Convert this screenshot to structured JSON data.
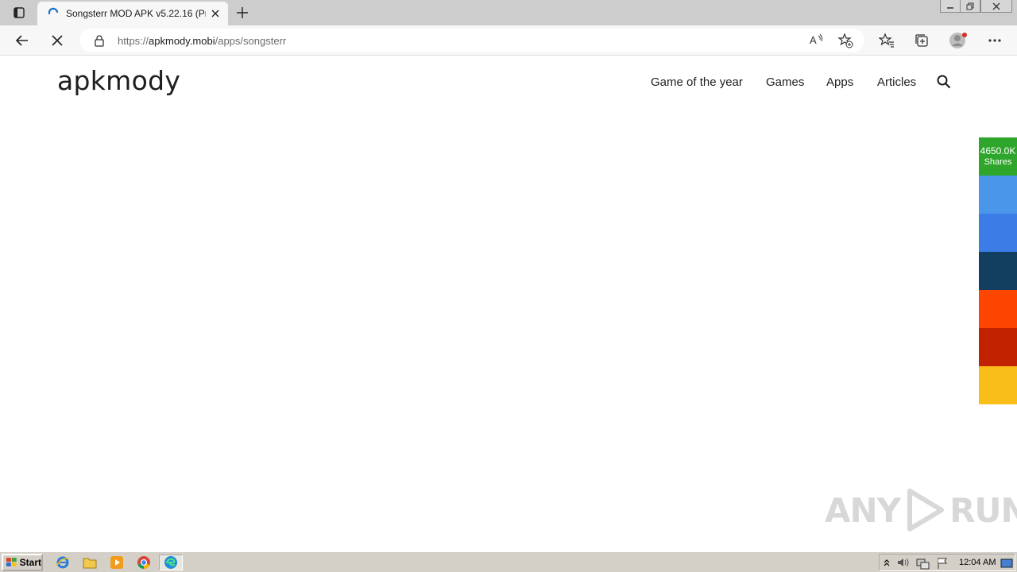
{
  "browser": {
    "tab_title": "Songsterr MOD APK v5.22.16 (Pre",
    "url_prefix": "https://",
    "url_host": "apkmody.mobi",
    "url_path": "/apps/songsterr"
  },
  "site": {
    "logo": "apkmody",
    "nav": [
      "Game of the year",
      "Games",
      "Apps",
      "Articles"
    ]
  },
  "share": {
    "count": "4650.0K",
    "label": "Shares",
    "colors": [
      "#4a96ea",
      "#3b7ce6",
      "#123e60",
      "#fb4500",
      "#c12300",
      "#f9be18"
    ],
    "count_color": "#2ea52b"
  },
  "watermark": {
    "left": "ANY",
    "right": "RUN"
  },
  "taskbar": {
    "start_label": "Start",
    "clock": "12:04 AM"
  }
}
